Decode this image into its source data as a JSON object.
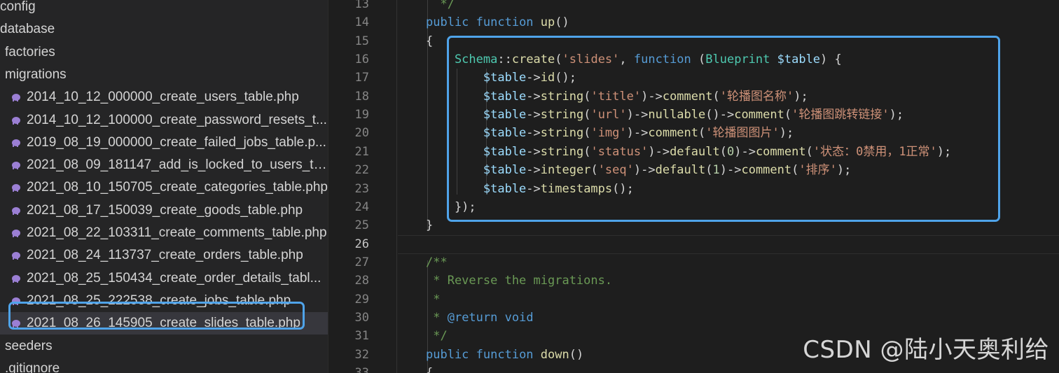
{
  "sidebar": {
    "items": [
      {
        "label": "config",
        "kind": "folder",
        "indent": 0
      },
      {
        "label": "database",
        "kind": "folder",
        "indent": 0
      },
      {
        "label": "factories",
        "kind": "folder",
        "indent": 1
      },
      {
        "label": "migrations",
        "kind": "folder",
        "indent": 1
      },
      {
        "label": "2014_10_12_000000_create_users_table.php",
        "kind": "php",
        "indent": 2
      },
      {
        "label": "2014_10_12_100000_create_password_resets_t...",
        "kind": "php",
        "indent": 2
      },
      {
        "label": "2019_08_19_000000_create_failed_jobs_table.p...",
        "kind": "php",
        "indent": 2
      },
      {
        "label": "2021_08_09_181147_add_is_locked_to_users_ta...",
        "kind": "php",
        "indent": 2
      },
      {
        "label": "2021_08_10_150705_create_categories_table.php",
        "kind": "php",
        "indent": 2
      },
      {
        "label": "2021_08_17_150039_create_goods_table.php",
        "kind": "php",
        "indent": 2
      },
      {
        "label": "2021_08_22_103311_create_comments_table.php",
        "kind": "php",
        "indent": 2
      },
      {
        "label": "2021_08_24_113737_create_orders_table.php",
        "kind": "php",
        "indent": 2
      },
      {
        "label": "2021_08_25_150434_create_order_details_tabl...",
        "kind": "php",
        "indent": 2
      },
      {
        "label": "2021_08_25_222538_create_jobs_table.php",
        "kind": "php",
        "indent": 2
      },
      {
        "label": "2021_08_26_145905_create_slides_table.php",
        "kind": "php",
        "indent": 2,
        "selected": true
      },
      {
        "label": "seeders",
        "kind": "folder",
        "indent": 1
      },
      {
        "label": ".gitignore",
        "kind": "file",
        "indent": 1
      }
    ]
  },
  "editor": {
    "active_line": "26",
    "lines": [
      {
        "n": "13",
        "tokens": [
          [
            "cm",
            "  */"
          ]
        ]
      },
      {
        "n": "14",
        "tokens": [
          [
            "kw",
            "public "
          ],
          [
            "kw",
            "function "
          ],
          [
            "fn",
            "up"
          ],
          [
            "op",
            "()"
          ]
        ]
      },
      {
        "n": "15",
        "tokens": [
          [
            "op",
            "{"
          ]
        ]
      },
      {
        "n": "16",
        "tokens": [
          [
            "cls",
            "    Schema"
          ],
          [
            "op",
            "::"
          ],
          [
            "fn",
            "create"
          ],
          [
            "op",
            "("
          ],
          [
            "str",
            "'slides'"
          ],
          [
            "op",
            ", "
          ],
          [
            "kw",
            "function "
          ],
          [
            "op",
            "("
          ],
          [
            "cls",
            "Blueprint "
          ],
          [
            "var",
            "$table"
          ],
          [
            "op",
            ") {"
          ]
        ]
      },
      {
        "n": "17",
        "tokens": [
          [
            "var",
            "        $table"
          ],
          [
            "op",
            "->"
          ],
          [
            "fn",
            "id"
          ],
          [
            "op",
            "();"
          ]
        ]
      },
      {
        "n": "18",
        "tokens": [
          [
            "var",
            "        $table"
          ],
          [
            "op",
            "->"
          ],
          [
            "fn",
            "string"
          ],
          [
            "op",
            "("
          ],
          [
            "str",
            "'title'"
          ],
          [
            "op",
            ")->"
          ],
          [
            "fn",
            "comment"
          ],
          [
            "op",
            "("
          ],
          [
            "str",
            "'轮播图名称'"
          ],
          [
            "op",
            ");"
          ]
        ]
      },
      {
        "n": "19",
        "tokens": [
          [
            "var",
            "        $table"
          ],
          [
            "op",
            "->"
          ],
          [
            "fn",
            "string"
          ],
          [
            "op",
            "("
          ],
          [
            "str",
            "'url'"
          ],
          [
            "op",
            ")->"
          ],
          [
            "fn",
            "nullable"
          ],
          [
            "op",
            "()->"
          ],
          [
            "fn",
            "comment"
          ],
          [
            "op",
            "("
          ],
          [
            "str",
            "'轮播图跳转链接'"
          ],
          [
            "op",
            ");"
          ]
        ]
      },
      {
        "n": "20",
        "tokens": [
          [
            "var",
            "        $table"
          ],
          [
            "op",
            "->"
          ],
          [
            "fn",
            "string"
          ],
          [
            "op",
            "("
          ],
          [
            "str",
            "'img'"
          ],
          [
            "op",
            ")->"
          ],
          [
            "fn",
            "comment"
          ],
          [
            "op",
            "("
          ],
          [
            "str",
            "'轮播图图片'"
          ],
          [
            "op",
            ");"
          ]
        ]
      },
      {
        "n": "21",
        "tokens": [
          [
            "var",
            "        $table"
          ],
          [
            "op",
            "->"
          ],
          [
            "fn",
            "string"
          ],
          [
            "op",
            "("
          ],
          [
            "str",
            "'status'"
          ],
          [
            "op",
            ")->"
          ],
          [
            "fn",
            "default"
          ],
          [
            "op",
            "("
          ],
          [
            "num",
            "0"
          ],
          [
            "op",
            ")->"
          ],
          [
            "fn",
            "comment"
          ],
          [
            "op",
            "("
          ],
          [
            "str",
            "'状态：0禁用，1正常'"
          ],
          [
            "op",
            ");"
          ]
        ]
      },
      {
        "n": "22",
        "tokens": [
          [
            "var",
            "        $table"
          ],
          [
            "op",
            "->"
          ],
          [
            "fn",
            "integer"
          ],
          [
            "op",
            "("
          ],
          [
            "str",
            "'seq'"
          ],
          [
            "op",
            ")->"
          ],
          [
            "fn",
            "default"
          ],
          [
            "op",
            "("
          ],
          [
            "num",
            "1"
          ],
          [
            "op",
            ")->"
          ],
          [
            "fn",
            "comment"
          ],
          [
            "op",
            "("
          ],
          [
            "str",
            "'排序'"
          ],
          [
            "op",
            ");"
          ]
        ]
      },
      {
        "n": "23",
        "tokens": [
          [
            "var",
            "        $table"
          ],
          [
            "op",
            "->"
          ],
          [
            "fn",
            "timestamps"
          ],
          [
            "op",
            "();"
          ]
        ]
      },
      {
        "n": "24",
        "tokens": [
          [
            "op",
            "    });"
          ]
        ]
      },
      {
        "n": "25",
        "tokens": [
          [
            "op",
            "}"
          ]
        ]
      },
      {
        "n": "26",
        "tokens": []
      },
      {
        "n": "27",
        "tokens": [
          [
            "cm",
            "/**"
          ]
        ]
      },
      {
        "n": "28",
        "tokens": [
          [
            "cm",
            " * Reverse the migrations."
          ]
        ]
      },
      {
        "n": "29",
        "tokens": [
          [
            "cm",
            " *"
          ]
        ]
      },
      {
        "n": "30",
        "tokens": [
          [
            "cm",
            " * "
          ],
          [
            "kw",
            "@return "
          ],
          [
            "kw",
            "void"
          ]
        ]
      },
      {
        "n": "31",
        "tokens": [
          [
            "cm",
            " */"
          ]
        ]
      },
      {
        "n": "32",
        "tokens": [
          [
            "kw",
            "public "
          ],
          [
            "kw",
            "function "
          ],
          [
            "fn",
            "down"
          ],
          [
            "op",
            "()"
          ]
        ]
      },
      {
        "n": "33",
        "tokens": [
          [
            "op",
            "{"
          ]
        ]
      }
    ]
  },
  "watermark": "CSDN @陆小天奥利给",
  "colors": {
    "accent_box": "#4fa3e9",
    "sidebar_bg": "#252526",
    "editor_bg": "#1e1e1e",
    "php_icon": "#9b7fd4"
  }
}
